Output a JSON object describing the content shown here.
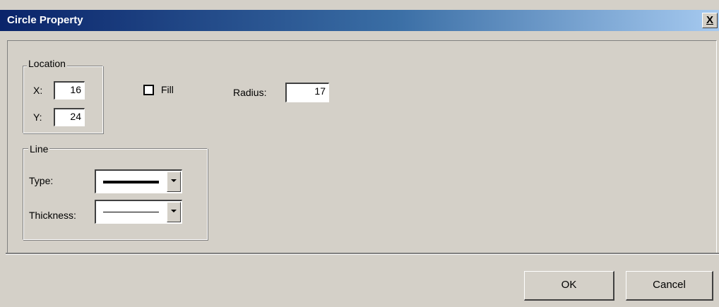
{
  "window": {
    "title": "Circle Property",
    "close_label": "X"
  },
  "location": {
    "group_label": "Location",
    "x_label": "X:",
    "x_value": "16",
    "y_label": "Y:",
    "y_value": "24"
  },
  "fill": {
    "label": "Fill",
    "checked": false
  },
  "radius": {
    "label": "Radius:",
    "value": "17"
  },
  "line": {
    "group_label": "Line",
    "type_label": "Type:",
    "type_selected": "thick-solid",
    "thickness_label": "Thickness:",
    "thickness_selected": "thin-solid"
  },
  "buttons": {
    "ok_label": "OK",
    "cancel_label": "Cancel"
  },
  "colors": {
    "title_start": "#0a246a",
    "title_end": "#a6caf0",
    "face": "#d4d0c8"
  }
}
